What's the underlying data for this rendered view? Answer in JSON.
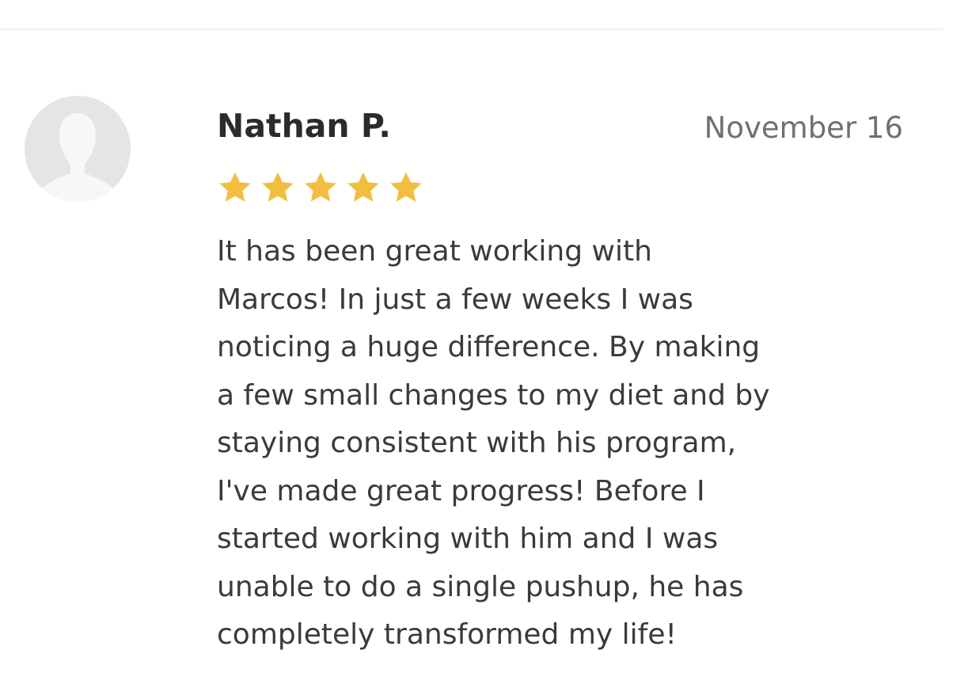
{
  "review": {
    "reviewer_name": "Nathan P.",
    "date": "November 16",
    "rating": 5,
    "rating_max": 5,
    "star_color": "#f2be42",
    "avatar_icon": "default-user-silhouette-icon",
    "text_lines": [
      "It has been great working with",
      "Marcos! In just a few weeks I was",
      "noticing a huge difference. By making",
      "a few small changes to my diet and by",
      "staying consistent with his program,",
      "I've made great progress! Before I",
      "started working with him and I was",
      "unable to do a single pushup, he has",
      "completely transformed my life!"
    ]
  }
}
